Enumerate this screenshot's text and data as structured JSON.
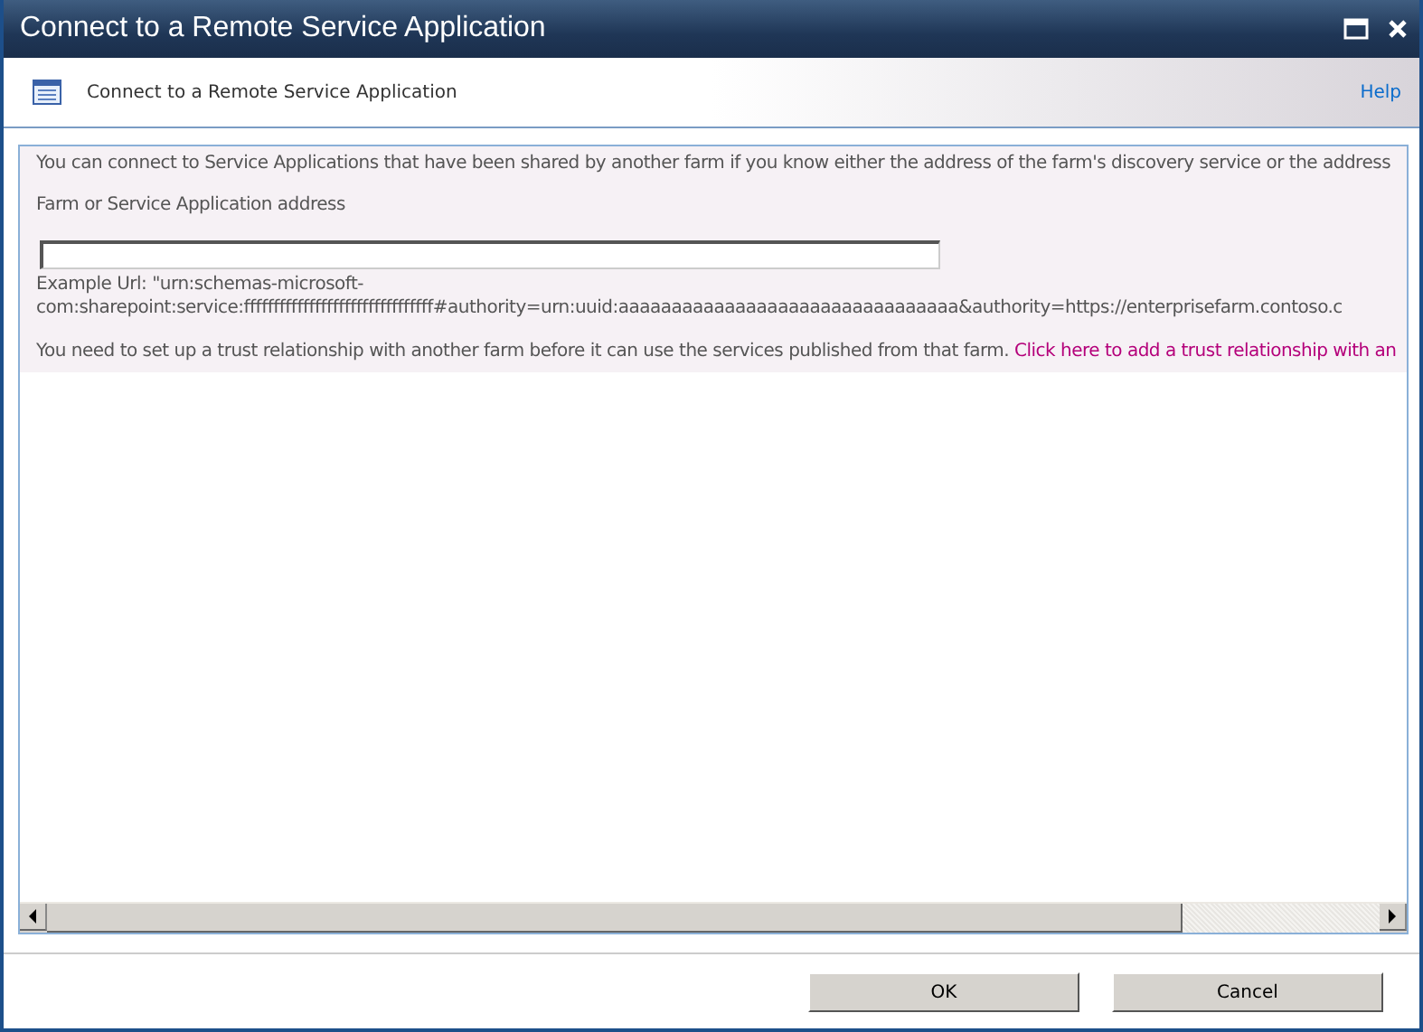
{
  "window": {
    "title": "Connect to a Remote Service Application"
  },
  "header": {
    "title": "Connect to a Remote Service Application",
    "help_link": "Help"
  },
  "content": {
    "intro": "You can connect to Service Applications that have been shared by another farm if you know either the address of the farm's discovery service or the address",
    "address_label": "Farm or Service Application address",
    "example_lines": [
      "Example Url: \"urn:schemas-microsoft-",
      "com:sharepoint:service:ffffffffffffffffffffffffffffffff#authority=urn:uuid:aaaaaaaaaaaaaaaaaaaaaaaaaaaaaaaa&authority=https://enterprisefarm.contoso.c"
    ],
    "trust_text": "You need to set up a trust relationship with another farm before it can use the services published from that farm.",
    "trust_link": "Click here to add a trust relationship with an"
  },
  "buttons": [
    "OK",
    "Cancel"
  ]
}
